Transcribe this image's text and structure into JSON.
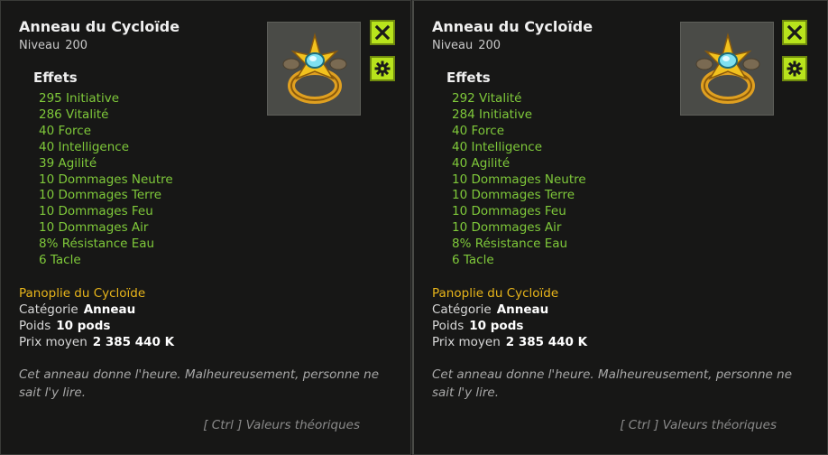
{
  "panels": [
    {
      "title": "Anneau du Cycloïde",
      "level_label": "Niveau",
      "level_value": "200",
      "effects_heading": "Effets",
      "effects": [
        "295 Initiative",
        "286 Vitalité",
        "40 Force",
        "40 Intelligence",
        "39 Agilité",
        "10 Dommages Neutre",
        "10 Dommages Terre",
        "10 Dommages Feu",
        "10 Dommages Air",
        "8% Résistance Eau",
        "6 Tacle"
      ],
      "set_name": "Panoplie du Cycloïde",
      "category_label": "Catégorie",
      "category_value": "Anneau",
      "weight_label": "Poids",
      "weight_value": "10 pods",
      "price_label": "Prix moyen",
      "price_value": "2 385 440 K",
      "description": "Cet anneau donne l'heure. Malheureusement, personne ne sait l'y lire.",
      "hint": "[ Ctrl ] Valeurs théoriques"
    },
    {
      "title": "Anneau du Cycloïde",
      "level_label": "Niveau",
      "level_value": "200",
      "effects_heading": "Effets",
      "effects": [
        "292 Vitalité",
        "284 Initiative",
        "40 Force",
        "40 Intelligence",
        "40 Agilité",
        "10 Dommages Neutre",
        "10 Dommages Terre",
        "10 Dommages Feu",
        "10 Dommages Air",
        "8% Résistance Eau",
        "6 Tacle"
      ],
      "set_name": "Panoplie du Cycloïde",
      "category_label": "Catégorie",
      "category_value": "Anneau",
      "weight_label": "Poids",
      "weight_value": "10 pods",
      "price_label": "Prix moyen",
      "price_value": "2 385 440 K",
      "description": "Cet anneau donne l'heure. Malheureusement, personne ne sait l'y lire.",
      "hint": "[ Ctrl ] Valeurs théoriques"
    }
  ],
  "icons": {
    "close": "close-icon",
    "settings": "gear-icon",
    "item": "ring-icon"
  },
  "colors": {
    "effect_green": "#7fc93a",
    "set_gold": "#e8b51a",
    "button_lime": "#b8e41c"
  }
}
